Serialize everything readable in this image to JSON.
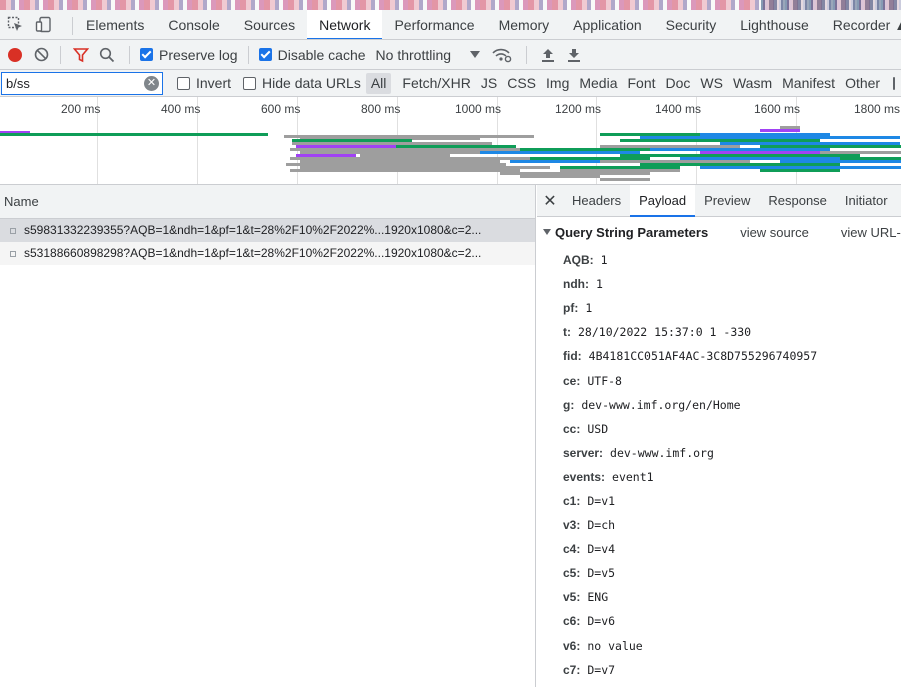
{
  "tabs": [
    {
      "label": "Elements"
    },
    {
      "label": "Console"
    },
    {
      "label": "Sources"
    },
    {
      "label": "Network",
      "active": true
    },
    {
      "label": "Performance"
    },
    {
      "label": "Memory"
    },
    {
      "label": "Application"
    },
    {
      "label": "Security"
    },
    {
      "label": "Lighthouse"
    },
    {
      "label": "Recorder"
    }
  ],
  "toolbar": {
    "preserve_log": "Preserve log",
    "disable_cache": "Disable cache",
    "throttling": "No throttling"
  },
  "filter": {
    "value": "b/ss",
    "invert": "Invert",
    "hide_data_urls": "Hide data URLs",
    "types": [
      "All",
      "Fetch/XHR",
      "JS",
      "CSS",
      "Img",
      "Media",
      "Font",
      "Doc",
      "WS",
      "Wasm",
      "Manifest",
      "Other"
    ]
  },
  "timeline": {
    "ticks": [
      "200 ms",
      "400 ms",
      "600 ms",
      "800 ms",
      "1000 ms",
      "1200 ms",
      "1400 ms",
      "1600 ms",
      "1800 ms"
    ]
  },
  "requests": {
    "header": "Name",
    "rows": [
      "s59831332239355?AQB=1&ndh=1&pf=1&t=28%2F10%2F2022%...1920x1080&c=2...",
      "s53188660898298?AQB=1&ndh=1&pf=1&t=28%2F10%2F2022%...1920x1080&c=2..."
    ]
  },
  "detail": {
    "tabs": [
      "Headers",
      "Payload",
      "Preview",
      "Response",
      "Initiator"
    ],
    "section_title": "Query String Parameters",
    "view_source": "view source",
    "view_url_encoded": "view URL-e",
    "params": [
      {
        "key": "AQB:",
        "value": "1"
      },
      {
        "key": "ndh:",
        "value": "1"
      },
      {
        "key": "pf:",
        "value": "1"
      },
      {
        "key": "t:",
        "value": "28/10/2022 15:37:0 1 -330"
      },
      {
        "key": "fid:",
        "value": "4B4181CC051AF4AC-3C8D755296740957"
      },
      {
        "key": "ce:",
        "value": "UTF-8"
      },
      {
        "key": "g:",
        "value": "dev-www.imf.org/en/Home"
      },
      {
        "key": "cc:",
        "value": "USD"
      },
      {
        "key": "server:",
        "value": "dev-www.imf.org"
      },
      {
        "key": "events:",
        "value": "event1"
      },
      {
        "key": "c1:",
        "value": "D=v1"
      },
      {
        "key": "v3:",
        "value": "D=ch"
      },
      {
        "key": "c4:",
        "value": "D=v4"
      },
      {
        "key": "c5:",
        "value": "D=v5"
      },
      {
        "key": "v5:",
        "value": "ENG"
      },
      {
        "key": "c6:",
        "value": "D=v6"
      },
      {
        "key": "v6:",
        "value": "no value"
      },
      {
        "key": "c7:",
        "value": "D=v7"
      }
    ]
  },
  "colors": {
    "accent": "#1a73e8",
    "record": "#d93025",
    "wf_green": "#0f9d58",
    "wf_blue": "#1e88e5",
    "wf_purple": "#a142f4",
    "wf_gray": "#9e9e9e"
  }
}
